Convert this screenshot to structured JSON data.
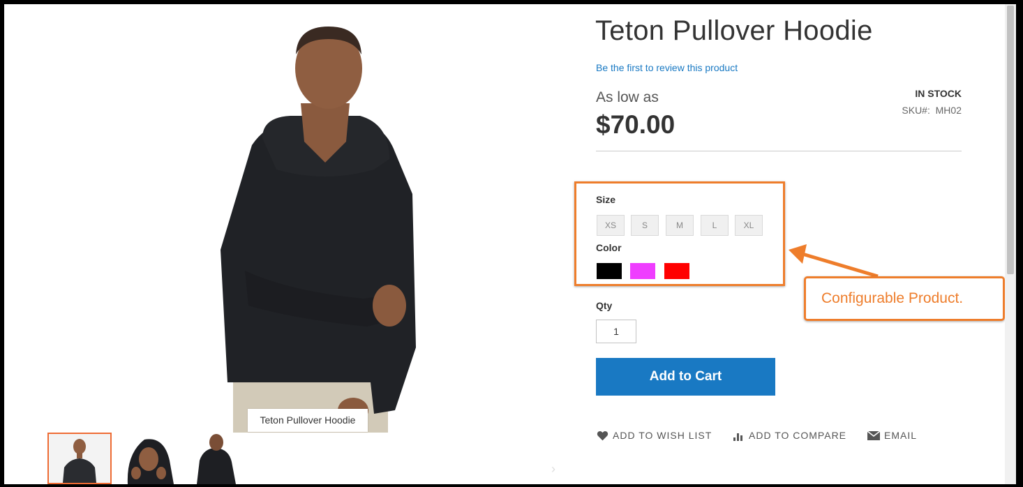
{
  "product": {
    "title": "Teton Pullover Hoodie",
    "review_link": "Be the first to review this product",
    "price_prefix": "As low as",
    "price": "$70.00",
    "stock_status": "IN STOCK",
    "sku_label": "SKU#:",
    "sku_value": "MH02"
  },
  "gallery": {
    "caption": "Teton Pullover Hoodie",
    "thumbnails": [
      "front",
      "hood",
      "back"
    ]
  },
  "options": {
    "size_label": "Size",
    "sizes": [
      "XS",
      "S",
      "M",
      "L",
      "XL"
    ],
    "color_label": "Color",
    "colors": [
      {
        "name": "Black",
        "hex": "#000000"
      },
      {
        "name": "Pink",
        "hex": "#ef3dff"
      },
      {
        "name": "Red",
        "hex": "#ff0000"
      }
    ]
  },
  "qty": {
    "label": "Qty",
    "value": "1"
  },
  "cart": {
    "button_label": "Add to Cart"
  },
  "actions": {
    "wishlist": "ADD TO WISH LIST",
    "compare": "ADD TO COMPARE",
    "email": "EMAIL"
  },
  "annotation": {
    "callout": "Configurable Product."
  },
  "colors": {
    "accent": "#1979c3",
    "annotation": "#ee7d2b"
  }
}
